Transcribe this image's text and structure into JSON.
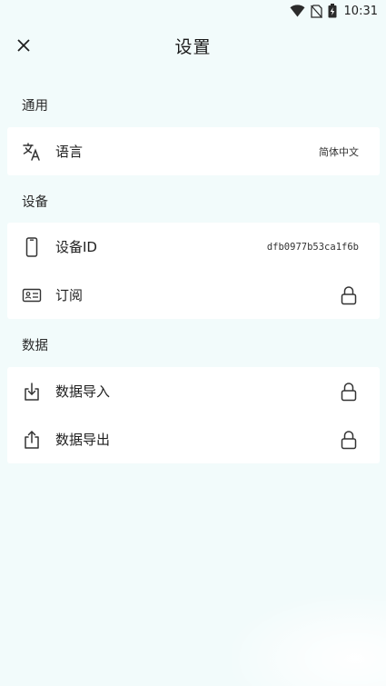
{
  "status_bar": {
    "time": "10:31",
    "icons": [
      "wifi-icon",
      "no-sim-icon",
      "battery-charging-icon"
    ]
  },
  "app_bar": {
    "title": "设置",
    "close_icon": "close-icon"
  },
  "sections": {
    "general": {
      "header": "通用",
      "items": [
        {
          "icon": "translate-icon",
          "label": "语言",
          "value": "简体中文"
        }
      ]
    },
    "device": {
      "header": "设备",
      "items": [
        {
          "icon": "phone-icon",
          "label": "设备ID",
          "value": "dfb0977b53ca1f6b"
        },
        {
          "icon": "id-card-icon",
          "label": "订阅",
          "trailing_icon": "lock-icon"
        }
      ]
    },
    "data": {
      "header": "数据",
      "items": [
        {
          "icon": "import-icon",
          "label": "数据导入",
          "trailing_icon": "lock-icon"
        },
        {
          "icon": "export-icon",
          "label": "数据导出",
          "trailing_icon": "lock-icon"
        }
      ]
    }
  },
  "colors": {
    "background": "#f2fbfb",
    "card": "#ffffff",
    "text": "#1f1f1f"
  }
}
